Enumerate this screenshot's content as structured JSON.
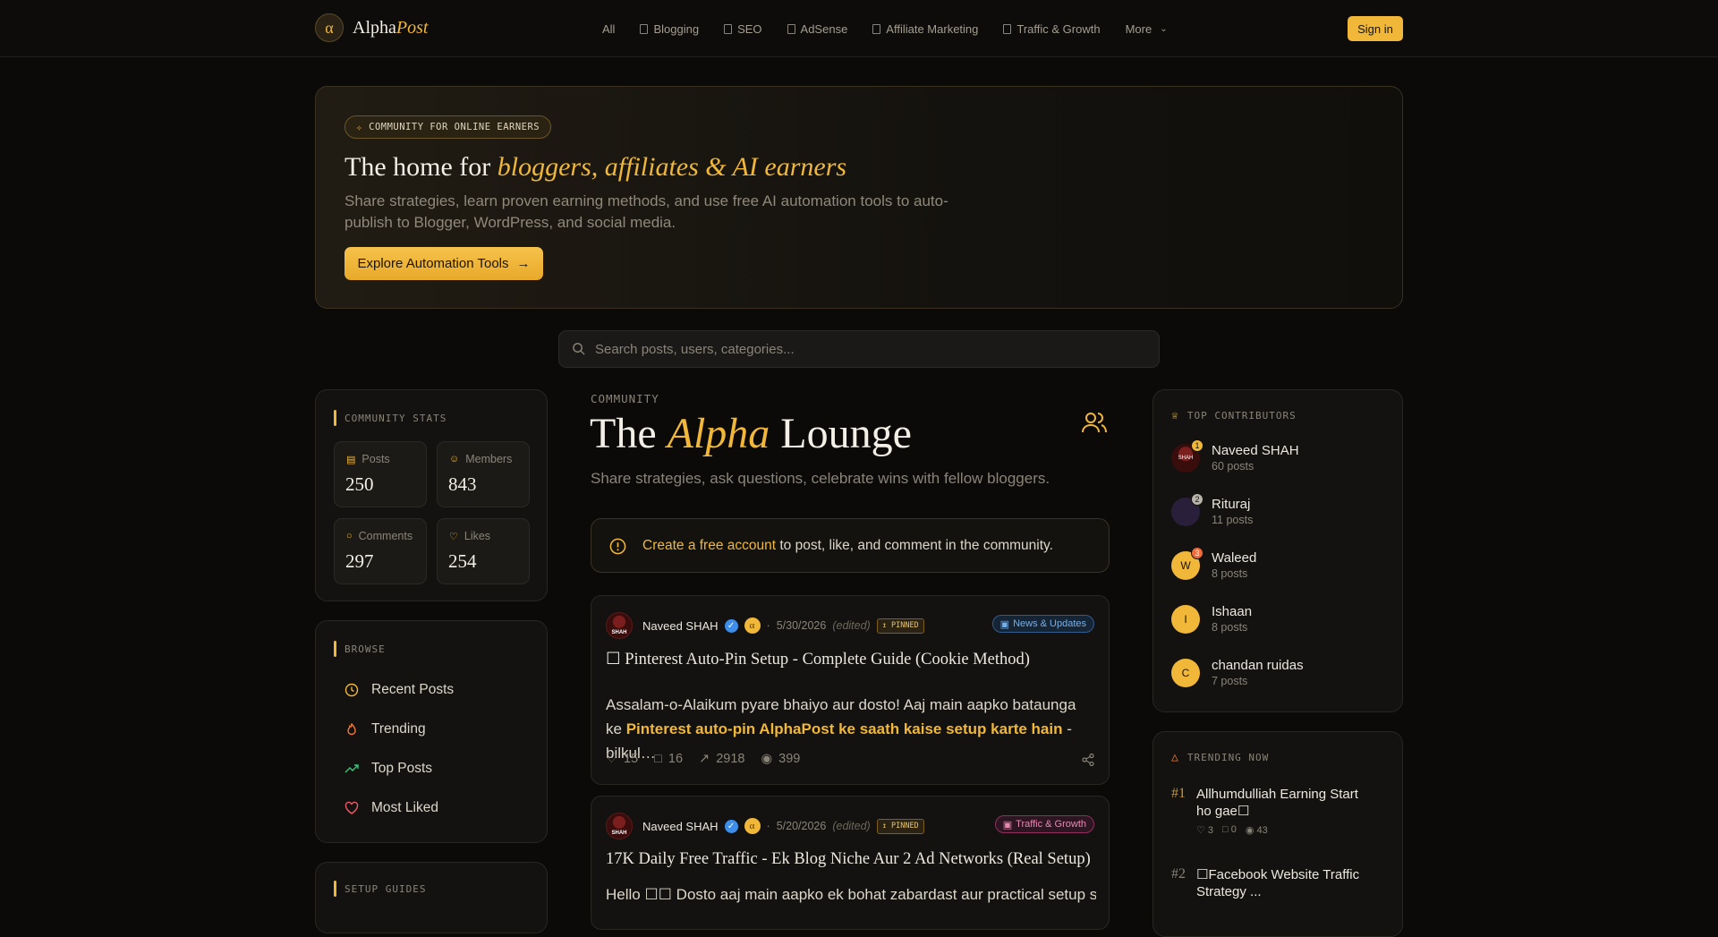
{
  "brand": {
    "mark": "α",
    "name_a": "Alpha",
    "name_b": "Post"
  },
  "nav": {
    "items": [
      {
        "label": "All"
      },
      {
        "label": "Blogging"
      },
      {
        "label": "SEO"
      },
      {
        "label": "AdSense"
      },
      {
        "label": "Affiliate Marketing"
      },
      {
        "label": "Traffic & Growth"
      }
    ],
    "more": "More",
    "signin": "Sign in"
  },
  "hero": {
    "badge": "COMMUNITY FOR ONLINE EARNERS",
    "title_a": "The home for ",
    "title_b": "bloggers, affiliates & AI earners",
    "subtitle": "Share strategies, learn proven earning methods, and use free AI automation tools to auto-publish to Blogger, WordPress, and social media.",
    "cta": "Explore Automation Tools"
  },
  "search": {
    "placeholder": "Search posts, users, categories..."
  },
  "stats": {
    "title": "COMMUNITY STATS",
    "posts_label": "Posts",
    "posts": "250",
    "members_label": "Members",
    "members": "843",
    "comments_label": "Comments",
    "comments": "297",
    "likes_label": "Likes",
    "likes": "254"
  },
  "browse": {
    "title": "BROWSE",
    "items": [
      {
        "label": "Recent Posts"
      },
      {
        "label": "Trending"
      },
      {
        "label": "Top Posts"
      },
      {
        "label": "Most Liked"
      }
    ],
    "next_title": "SETUP GUIDES"
  },
  "main": {
    "label": "COMMUNITY",
    "title_a": "The ",
    "title_b": "Alpha",
    "title_c": " Lounge",
    "subtitle": "Share strategies, ask questions, celebrate wins with fellow bloggers.",
    "notice_link": "Create a free account",
    "notice_rest": " to post, like, and comment in the community."
  },
  "posts": [
    {
      "author": "Naveed SHAH",
      "date": "5/30/2026",
      "edited": "(edited)",
      "pinned": "PINNED",
      "category": "News & Updates",
      "title": "☐ Pinterest Auto-Pin Setup - Complete Guide (Cookie Method)",
      "body_a": "Assalam-o-Alaikum pyare bhaiyo aur dosto! Aaj main aapko bataunga ke ",
      "body_b": "Pinterest auto-pin AlphaPost ke saath kaise setup karte hain",
      "body_c": " - bilkul…",
      "likes": "15",
      "comments": "16",
      "reach": "2918",
      "views": "399"
    },
    {
      "author": "Naveed SHAH",
      "date": "5/20/2026",
      "edited": "(edited)",
      "pinned": "PINNED",
      "category": "Traffic & Growth",
      "title": "17K Daily Free Traffic - Ek Blog Niche Aur 2 Ad Networks (Real Setup)",
      "body_a": "Hello ☐☐ Dosto aaj main aapko ek bohat zabardast aur practical setup share karunga..."
    }
  ],
  "contributors": {
    "title": "TOP CONTRIBUTORS",
    "items": [
      {
        "name": "Naveed SHAH",
        "posts": "60 posts",
        "rank": "1",
        "initial": ""
      },
      {
        "name": "Rituraj",
        "posts": "11 posts",
        "rank": "2",
        "initial": ""
      },
      {
        "name": "Waleed",
        "posts": "8 posts",
        "rank": "3",
        "initial": "W"
      },
      {
        "name": "Ishaan",
        "posts": "8 posts",
        "rank": "",
        "initial": "I"
      },
      {
        "name": "chandan ruidas",
        "posts": "7 posts",
        "rank": "",
        "initial": "C"
      }
    ]
  },
  "trending": {
    "title": "TRENDING NOW",
    "items": [
      {
        "rank": "#1",
        "title": "Allhumdulliah Earning Start ho gae☐",
        "likes": "3",
        "comments": "0",
        "views": "43"
      },
      {
        "rank": "#2",
        "title": "☐Facebook Website Traffic Strategy ..."
      }
    ]
  },
  "colors": {
    "accent": "#f0b739",
    "background": "#0b0a09",
    "verified": "#3d8ee8"
  }
}
